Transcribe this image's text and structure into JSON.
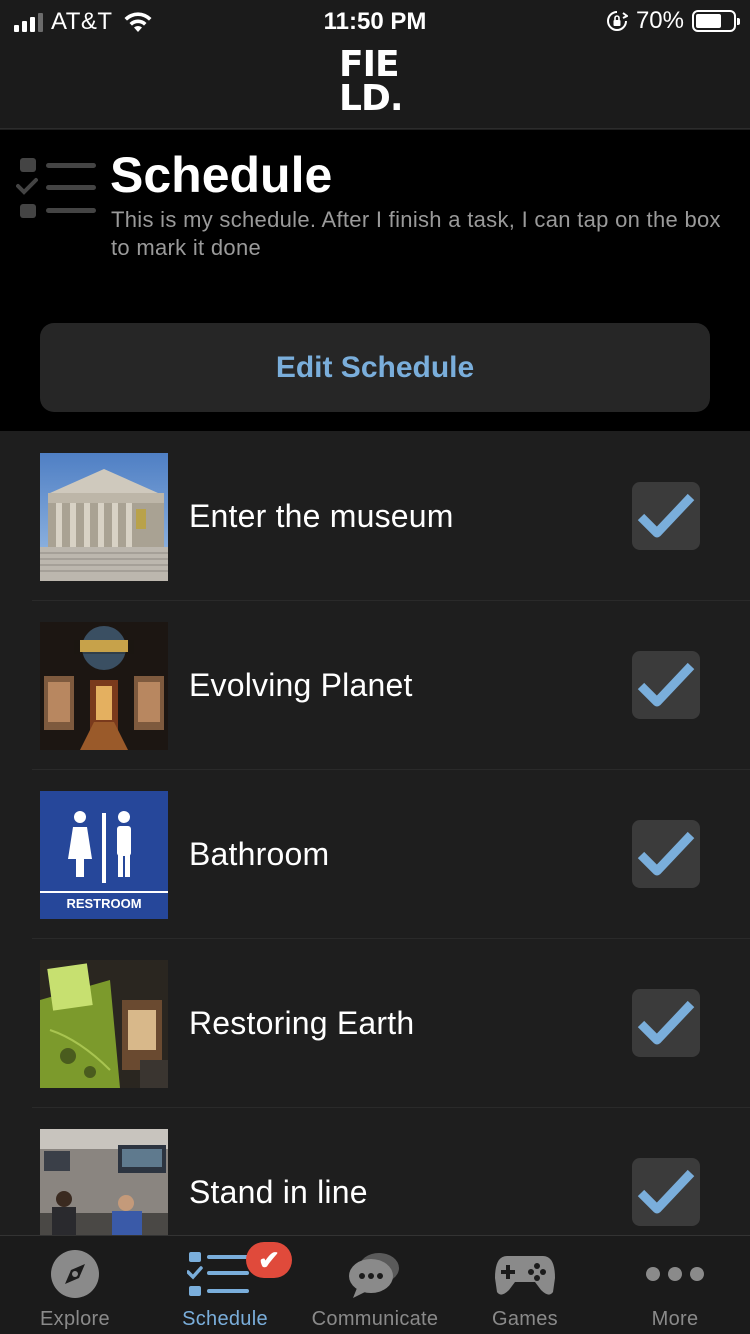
{
  "status_bar": {
    "carrier": "AT&T",
    "time": "11:50 PM",
    "battery_percent": "70%",
    "battery_level": 0.7
  },
  "header": {
    "logo_line1": "FIE",
    "logo_line2": "LD."
  },
  "page": {
    "title": "Schedule",
    "subtitle": "This is my schedule. After I finish a task, I can tap on the box to mark it done",
    "edit_button": "Edit Schedule"
  },
  "schedule": [
    {
      "label": "Enter the museum",
      "done": true,
      "image": "museum-building"
    },
    {
      "label": "Evolving Planet",
      "done": true,
      "image": "evolving-planet-exhibit"
    },
    {
      "label": "Bathroom",
      "done": true,
      "image": "restroom-sign",
      "image_text": "RESTROOM"
    },
    {
      "label": "Restoring Earth",
      "done": true,
      "image": "restoring-earth-exhibit"
    },
    {
      "label": "Stand in line",
      "done": true,
      "image": "ticket-line"
    }
  ],
  "tabs": [
    {
      "label": "Explore",
      "icon": "compass-icon",
      "active": false
    },
    {
      "label": "Schedule",
      "icon": "checklist-icon",
      "active": true,
      "badge": "✔"
    },
    {
      "label": "Communicate",
      "icon": "chat-bubbles-icon",
      "active": false
    },
    {
      "label": "Games",
      "icon": "gamepad-icon",
      "active": false
    },
    {
      "label": "More",
      "icon": "more-dots-icon",
      "active": false
    }
  ],
  "colors": {
    "accent": "#7aaedb",
    "badge": "#e04a3b",
    "background": "#1e1e1e"
  }
}
